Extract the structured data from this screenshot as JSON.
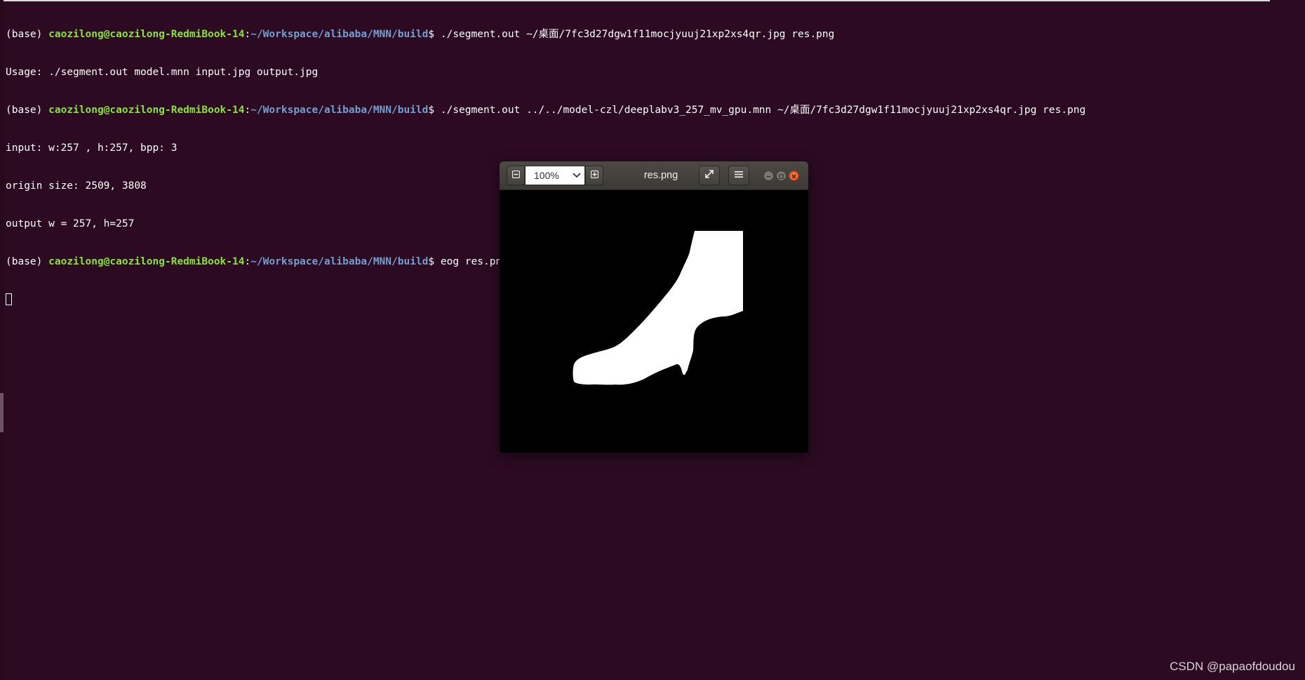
{
  "terminal": {
    "lines": [
      {
        "type": "prompt",
        "env": "(base)",
        "user_host": "caozilong@caozilong-RedmiBook-14",
        "path": "~/Workspace/alibaba/MNN/build",
        "command": "./segment.out ~/桌面/7fc3d27dgw1f11mocjyuuj21xp2xs4qr.jpg res.png"
      },
      {
        "type": "output",
        "text": "Usage: ./segment.out model.mnn input.jpg output.jpg"
      },
      {
        "type": "prompt",
        "env": "(base)",
        "user_host": "caozilong@caozilong-RedmiBook-14",
        "path": "~/Workspace/alibaba/MNN/build",
        "command": "./segment.out ../../model-czl/deeplabv3_257_mv_gpu.mnn ~/桌面/7fc3d27dgw1f11mocjyuuj21xp2xs4qr.jpg res.png"
      },
      {
        "type": "output",
        "text": "input: w:257 , h:257, bpp: 3"
      },
      {
        "type": "output",
        "text": "origin size: 2509, 3808"
      },
      {
        "type": "output",
        "text": "output w = 257, h=257"
      },
      {
        "type": "prompt",
        "env": "(base)",
        "user_host": "caozilong@caozilong-RedmiBook-14",
        "path": "~/Workspace/alibaba/MNN/build",
        "command": "eog res.png"
      }
    ],
    "colors": {
      "background": "#2c0b22",
      "user_host": "#8ae234",
      "path": "#729fcf",
      "text": "#ffffff"
    }
  },
  "viewer": {
    "title": "res.png",
    "zoom_value": "100%",
    "icons": {
      "zoom_out": "minus-icon",
      "zoom_in": "plus-icon",
      "dropdown": "chevron-down-icon",
      "fullscreen": "fullscreen-icon",
      "menu": "hamburger-menu-icon",
      "minimize": "minimize-icon",
      "maximize": "maximize-icon",
      "close": "close-icon"
    }
  },
  "watermark": {
    "text": "CSDN @papaofdoudou"
  }
}
